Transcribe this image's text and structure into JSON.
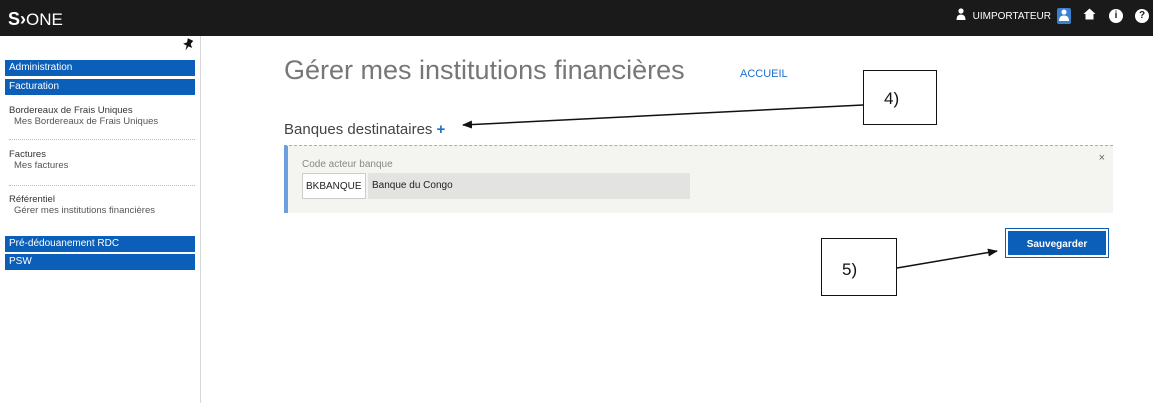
{
  "header": {
    "logo_s": "S",
    "logo_one": "ONE",
    "username": "UIMPORTATEUR",
    "icons": [
      "user-icon",
      "switch-user-icon",
      "home-icon",
      "info-icon",
      "help-icon"
    ]
  },
  "sidebar": {
    "pin_icon": "pin-icon",
    "sections": [
      {
        "label": "Administration"
      },
      {
        "label": "Facturation"
      }
    ],
    "groups": [
      {
        "title": "Bordereaux de Frais Uniques",
        "sub": "Mes Bordereaux de Frais Uniques"
      },
      {
        "title": "Factures",
        "sub": "Mes factures"
      },
      {
        "title": "Référentiel",
        "sub": "Gérer mes institutions financières"
      }
    ],
    "bottom_sections": [
      {
        "label": "Pré-dédouanement RDC"
      },
      {
        "label": "PSW"
      }
    ]
  },
  "main": {
    "title": "Gérer mes institutions financières",
    "breadcrumb": "ACCUEIL",
    "section_title": "Banques destinataires",
    "add_symbol": "+",
    "panel": {
      "field_label": "Code acteur banque",
      "code_value": "BKBANQUE",
      "bank_name": "Banque du Congo",
      "close_symbol": "×"
    },
    "save_label": "Sauvegarder"
  },
  "annotations": {
    "callout_4": "4)",
    "callout_5": "5)"
  },
  "colors": {
    "topbar": "#1a1a1a",
    "nav_blue": "#0b5fb8",
    "link_blue": "#1f6fcc"
  }
}
